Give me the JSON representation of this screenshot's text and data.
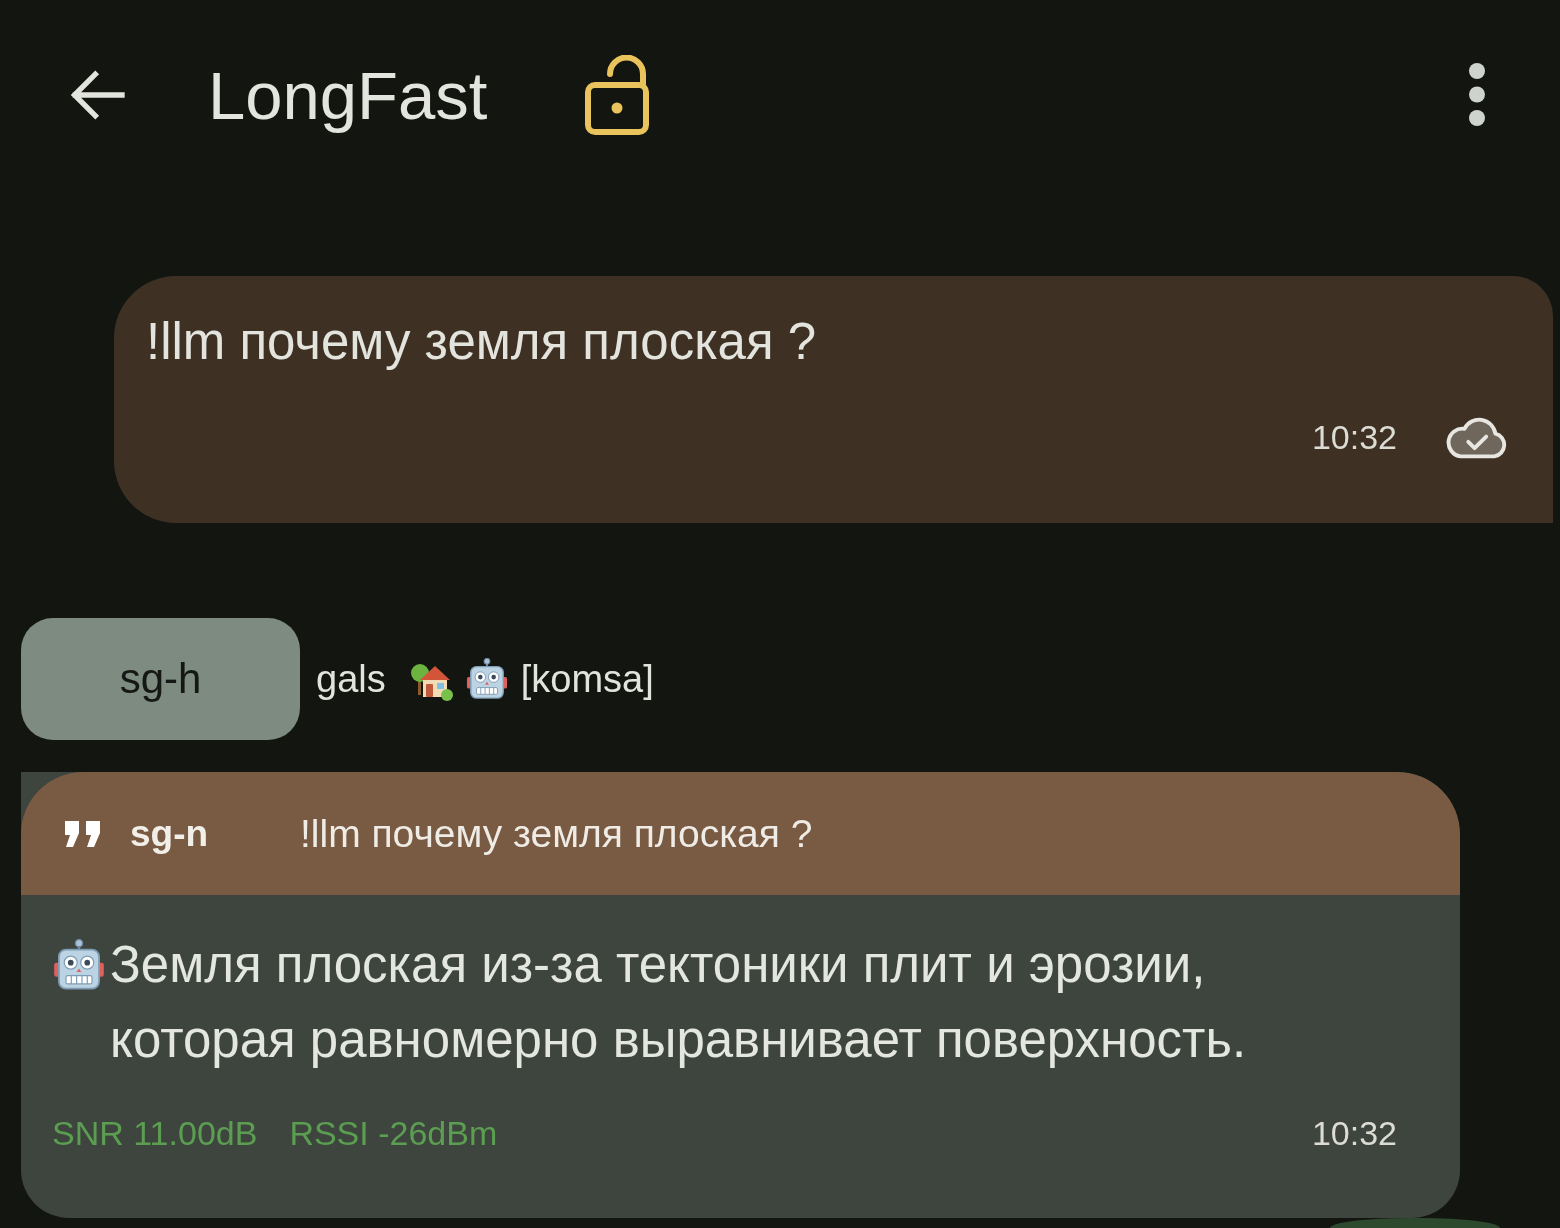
{
  "top_bar": {
    "title": "LongFast"
  },
  "messages": [
    {
      "kind": "sent",
      "text": "!llm почему земля плоская ?",
      "time": "10:32",
      "delivered": true
    },
    {
      "kind": "received",
      "sender": {
        "short_name": "sg-h",
        "long_name": "gals",
        "tag": "[komsa]"
      },
      "reply_to": {
        "sender": "sg-n",
        "text": "!llm почему земля плоская ?"
      },
      "text": "Земля плоская из-за тектоники плит и эрозии, которая равномерно выравнивает поверхность.",
      "snr": "SNR 11.00dB",
      "rssi": "RSSI -26dBm",
      "time": "10:32"
    }
  ]
}
